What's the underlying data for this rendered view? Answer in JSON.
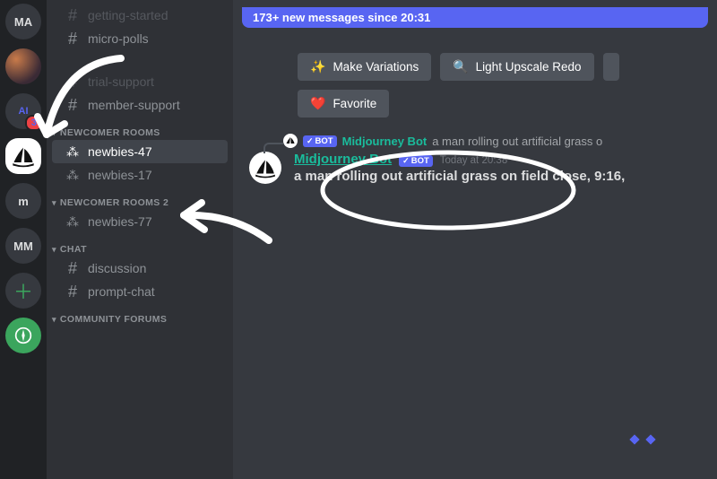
{
  "servers": {
    "ma": "MA",
    "badge": "3",
    "m": "m",
    "mm": "MM"
  },
  "channels": {
    "getting_started": "getting-started",
    "micro_polls": "micro-polls",
    "trial_support": "trial-support",
    "member_support": "member-support",
    "cat_newcomer": "NEWCOMER ROOMS",
    "newbies_47": "newbies-47",
    "newbies_17": "newbies-17",
    "cat_newcomer2": "NEWCOMER ROOMS 2",
    "newbies_77": "newbies-77",
    "cat_chat": "CHAT",
    "discussion": "discussion",
    "prompt_chat": "prompt-chat",
    "cat_forums": "COMMUNITY FORUMS"
  },
  "banner": "173+ new messages since 20:31",
  "buttons": {
    "make_variations": "Make Variations",
    "light_upscale": "Light Upscale Redo",
    "favorite": "Favorite"
  },
  "reply": {
    "bot_tag": "BOT",
    "name": "Midjourney Bot",
    "text": "a man rolling out artificial grass o"
  },
  "message": {
    "author": "Midjourney Bot",
    "bot_tag": "BOT",
    "time": "Today at 20:38",
    "text": "a man rolling out artificial grass on field close, 9:16,"
  }
}
